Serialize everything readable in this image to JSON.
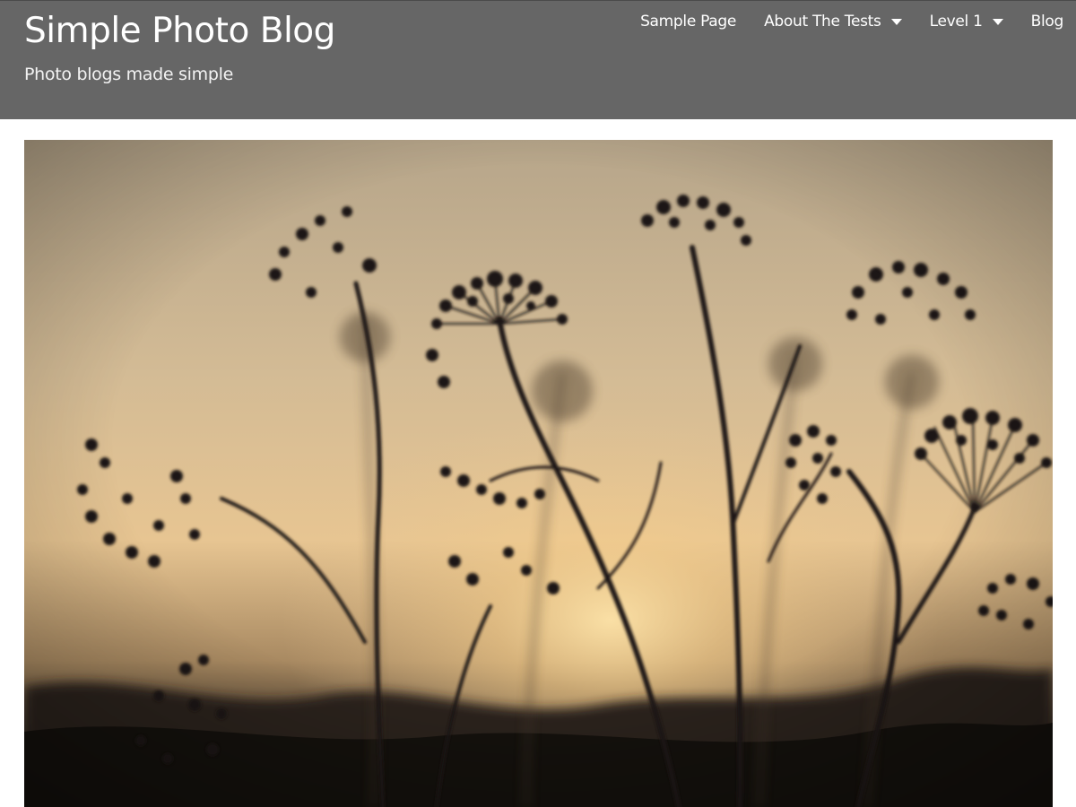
{
  "site": {
    "title": "Simple Photo Blog",
    "tagline": "Photo blogs made simple"
  },
  "nav": {
    "items": [
      {
        "label": "Sample Page",
        "has_dropdown": false
      },
      {
        "label": "About The Tests",
        "has_dropdown": true
      },
      {
        "label": "Level 1",
        "has_dropdown": true
      },
      {
        "label": "Blog",
        "has_dropdown": false
      }
    ]
  },
  "colors": {
    "header_background": "#666666",
    "header_text": "#ffffff",
    "page_background": "#ffffff"
  },
  "icons": {
    "dropdown": "chevron-down-icon"
  }
}
